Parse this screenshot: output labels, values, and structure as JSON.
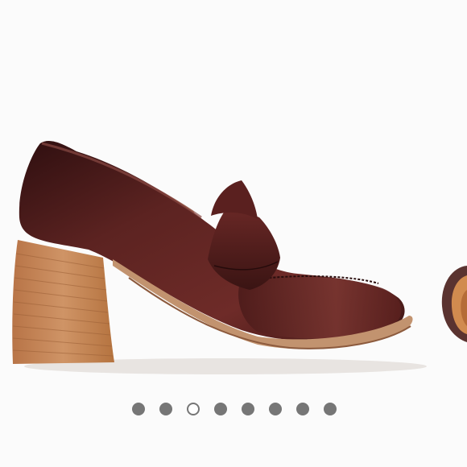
{
  "carousel": {
    "slide_count": 8,
    "active_index": 2,
    "dot_color": "#767676",
    "main_image_icon": "burgundy-leather-heeled-loafer",
    "peek_image_icon": "next-shoe-preview"
  },
  "colors": {
    "leather_dark": "#3a1414",
    "leather_mid": "#6b2a26",
    "leather_light": "#8a4a44",
    "heel_wood": "#c8875a",
    "heel_wood_dark": "#a8683e",
    "sole": "#c49575",
    "background": "#fbfbfb"
  }
}
